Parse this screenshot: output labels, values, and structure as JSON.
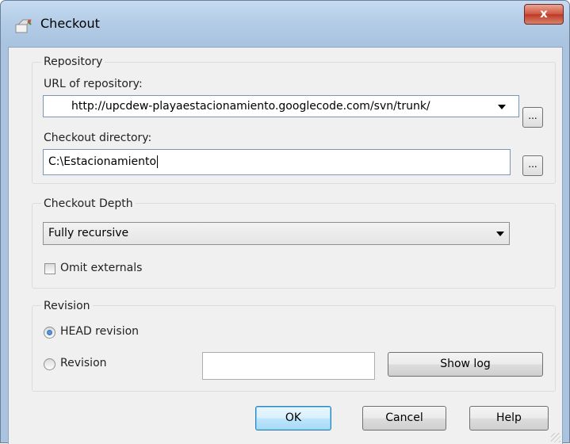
{
  "window": {
    "title": "Checkout",
    "close_symbol": "x",
    "title_icon": "svn-checkout-icon",
    "close_color": "#c7422e"
  },
  "repository": {
    "group_label": "Repository",
    "url_label": "URL of repository:",
    "url_value": "http://upcdew-playaestacionamiento.googlecode.com/svn/trunk/",
    "dir_label": "Checkout directory:",
    "dir_value": "C:\\Estacionamiento",
    "browse_label": "..."
  },
  "depth": {
    "group_label": "Checkout Depth",
    "selected": "Fully recursive",
    "omit_externals_label": "Omit externals",
    "omit_externals_checked": false
  },
  "revision": {
    "group_label": "Revision",
    "head_label": "HEAD revision",
    "head_selected": true,
    "revision_label": "Revision",
    "revision_value": "",
    "show_log_label": "Show log"
  },
  "buttons": {
    "ok": "OK",
    "cancel": "Cancel",
    "help": "Help"
  }
}
